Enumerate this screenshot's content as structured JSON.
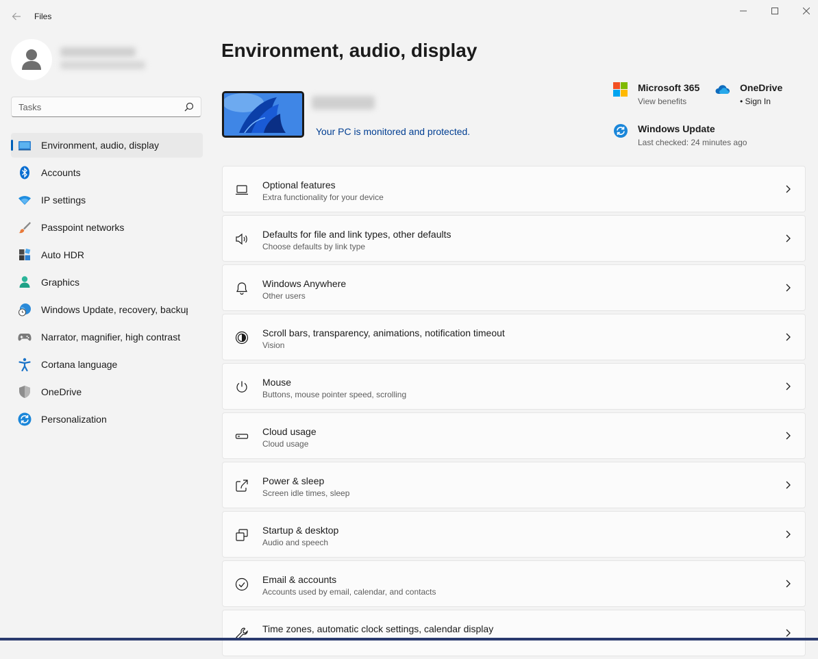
{
  "window": {
    "title": "Files"
  },
  "search": {
    "placeholder": "Tasks"
  },
  "sidebar": {
    "items": [
      {
        "label": "Environment, audio, display",
        "icon": "display-icon",
        "active": true
      },
      {
        "label": "Accounts",
        "icon": "bluetooth-icon"
      },
      {
        "label": "IP settings",
        "icon": "wifi-icon"
      },
      {
        "label": "Passpoint networks",
        "icon": "brush-icon"
      },
      {
        "label": "Auto HDR",
        "icon": "apps-icon"
      },
      {
        "label": "Graphics",
        "icon": "person-icon"
      },
      {
        "label": "Windows Update, recovery, backup",
        "icon": "globe-clock-icon"
      },
      {
        "label": "Narrator, magnifier, high contrast",
        "icon": "gamepad-icon"
      },
      {
        "label": "Cortana language",
        "icon": "accessibility-icon"
      },
      {
        "label": "OneDrive",
        "icon": "shield-icon"
      },
      {
        "label": "Personalization",
        "icon": "sync-icon"
      }
    ]
  },
  "main": {
    "title": "Environment, audio, display",
    "device": {
      "status": "Your PC is monitored and protected."
    },
    "services": {
      "ms365": {
        "title": "Microsoft 365",
        "subtitle": "View benefits"
      },
      "onedrive": {
        "title": "OneDrive",
        "subtitle": "• Sign In"
      },
      "update": {
        "title": "Windows Update",
        "subtitle": "Last checked: 24 minutes ago"
      }
    },
    "cards": [
      {
        "title": "Optional features",
        "subtitle": "Extra functionality for your device",
        "icon": "laptop-icon"
      },
      {
        "title": "Defaults for file and link types, other defaults",
        "subtitle": "Choose defaults by link type",
        "icon": "speaker-icon"
      },
      {
        "title": "Windows Anywhere",
        "subtitle": "Other users",
        "icon": "bell-icon"
      },
      {
        "title": "Scroll bars, transparency, animations, notification timeout",
        "subtitle": "Vision",
        "icon": "contrast-icon"
      },
      {
        "title": "Mouse",
        "subtitle": "Buttons, mouse pointer speed, scrolling",
        "icon": "power-icon"
      },
      {
        "title": "Cloud usage",
        "subtitle": "Cloud usage",
        "icon": "storage-icon"
      },
      {
        "title": "Power & sleep",
        "subtitle": "Screen idle times, sleep",
        "icon": "share-icon"
      },
      {
        "title": "Startup & desktop",
        "subtitle": "Audio and speech",
        "icon": "multitask-icon"
      },
      {
        "title": "Email & accounts",
        "subtitle": "Accounts used by email, calendar, and contacts",
        "icon": "check-circle-icon"
      },
      {
        "title": "Time zones, automatic clock settings, calendar display",
        "subtitle": "",
        "icon": "wrench-icon"
      }
    ]
  },
  "colors": {
    "accent": "#005fb8",
    "link": "#003e92",
    "background": "#f3f3f3",
    "card": "#fbfbfb"
  }
}
